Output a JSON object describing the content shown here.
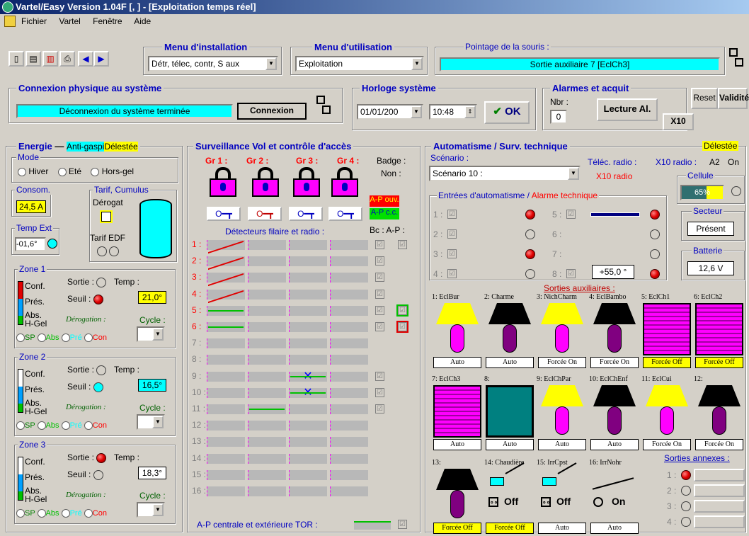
{
  "window": {
    "title": "Vartel/Easy Version 1.04F [, ] - [Exploitation temps réel]"
  },
  "menu": [
    "Fichier",
    "Vartel",
    "Fenêtre",
    "Aide"
  ],
  "install": {
    "label": "Menu d'installation",
    "value": "Détr, télec, contr, S aux"
  },
  "usage": {
    "label": "Menu d'utilisation",
    "value": "Exploitation"
  },
  "pointer": {
    "label": "Pointage de la souris :",
    "value": "Sortie auxiliaire 7 [EclCh3]"
  },
  "connexion": {
    "label": "Connexion physique au système",
    "status": "Déconnexion du système terminée",
    "button": "Connexion"
  },
  "horloge": {
    "label": "Horloge système",
    "date": "01/01/200",
    "time": "10:48",
    "ok": "OK"
  },
  "alarmes": {
    "label": "Alarmes et acquit",
    "nbr_label": "Nbr :",
    "nbr": "0",
    "button": "Lecture Al.",
    "reset": "Reset",
    "valid": "Validité",
    "x10": "X10"
  },
  "energie": {
    "label": "Energie",
    "antigaspi": "Anti-gaspi",
    "delestee": "Délestée",
    "mode_label": "Mode",
    "modes": [
      "Hiver",
      "Eté",
      "Hors-gel"
    ],
    "consom_label": "Consom.",
    "consom": "24,5 A",
    "tarif_label": "Tarif, Cumulus",
    "derogat": "Dérogat",
    "tarif_edf": "Tarif EDF",
    "temp_ext_label": "Temp Ext",
    "temp_ext": "-01,6°"
  },
  "zones": [
    {
      "label": "Zone 1",
      "temp": "21,0°"
    },
    {
      "label": "Zone 2",
      "temp": "16,5°"
    },
    {
      "label": "Zone 3",
      "temp": "18,3°"
    }
  ],
  "zone_common": {
    "conf": "Conf.",
    "pres": "Prés.",
    "abs": "Abs.",
    "hgel": "H-Gel",
    "sortie": "Sortie :",
    "seuil": "Seuil :",
    "temp": "Temp :",
    "derog": "Dérogation :",
    "cycle": "Cycle :",
    "sp": "SP",
    "absr": "Abs",
    "pre": "Pré",
    "con": "Con"
  },
  "vol": {
    "label": "Surveillance Vol et contrôle d'accès",
    "groups": [
      "Gr 1 :",
      "Gr 2 :",
      "Gr 3 :",
      "Gr 4 :"
    ],
    "badge": "Badge :",
    "non": "Non :",
    "ap_ouv": "A-P ouv.",
    "ap_cc": "A-P c.c.",
    "detect_title": "Détecteurs filaire et radio :",
    "bc": "Bc : A-P :",
    "rows": [
      "1 :",
      "2 :",
      "3 :",
      "4 :",
      "5 :",
      "6 :",
      "7 :",
      "8 :",
      "9 :",
      "10 :",
      "11 :",
      "12 :",
      "13 :",
      "14 :",
      "15 :",
      "16 :"
    ],
    "footer": "A-P centrale et extérieure TOR :"
  },
  "auto": {
    "label": "Automatisme / Surv. technique",
    "delestee": "Délestée",
    "scen_label": "Scénario :",
    "scenario": "Scénario 10 :",
    "telec": "Téléc. radio :",
    "x10": "X10 radio :",
    "x10v": "A2",
    "on": "On",
    "x10radio": "X10 radio",
    "cellule": "Cellule",
    "cell_val": "65%",
    "entrees_title": "Entrées d'automatisme /",
    "alarme_tech": "Alarme technique",
    "inputs": [
      "1 :",
      "2 :",
      "3 :",
      "4 :",
      "5 :",
      "6 :",
      "7 :",
      "8 :"
    ],
    "val8": "+55,0 °",
    "secteur": "Secteur",
    "secteur_v": "Présent",
    "batterie": "Batterie",
    "batterie_v": "12,6 V"
  },
  "sorties": {
    "title": "Sorties auxiliaires :",
    "items": [
      {
        "name": "1: EclBur",
        "state": "Auto"
      },
      {
        "name": "2: Charme",
        "state": "Auto"
      },
      {
        "name": "3: NichCharm",
        "state": "Forcée On"
      },
      {
        "name": "4: EclBambo",
        "state": "Forcée On"
      },
      {
        "name": "5: EclCh1",
        "state": "Forcée Off"
      },
      {
        "name": "6: EclCh2",
        "state": "Forcée Off"
      },
      {
        "name": "7: EclCh3",
        "state": "Auto"
      },
      {
        "name": "8:",
        "state": "Auto"
      },
      {
        "name": "9: EclChPar",
        "state": "Auto"
      },
      {
        "name": "10: EclChEnf",
        "state": "Auto"
      },
      {
        "name": "11: EclCui",
        "state": "Forcée On"
      },
      {
        "name": "12:",
        "state": "Forcée On"
      },
      {
        "name": "13:",
        "state": "Forcée Off"
      },
      {
        "name": "14: Chaudière",
        "state": "Forcée Off"
      },
      {
        "name": "15: IrrCpst",
        "state": "Auto"
      },
      {
        "name": "16: IrrNohr",
        "state": "Auto"
      }
    ],
    "off": "Off",
    "on": "On",
    "annexes": "Sorties annexes :",
    "annex_rows": [
      "1 :",
      "2 :",
      "3 :",
      "4 :"
    ]
  }
}
